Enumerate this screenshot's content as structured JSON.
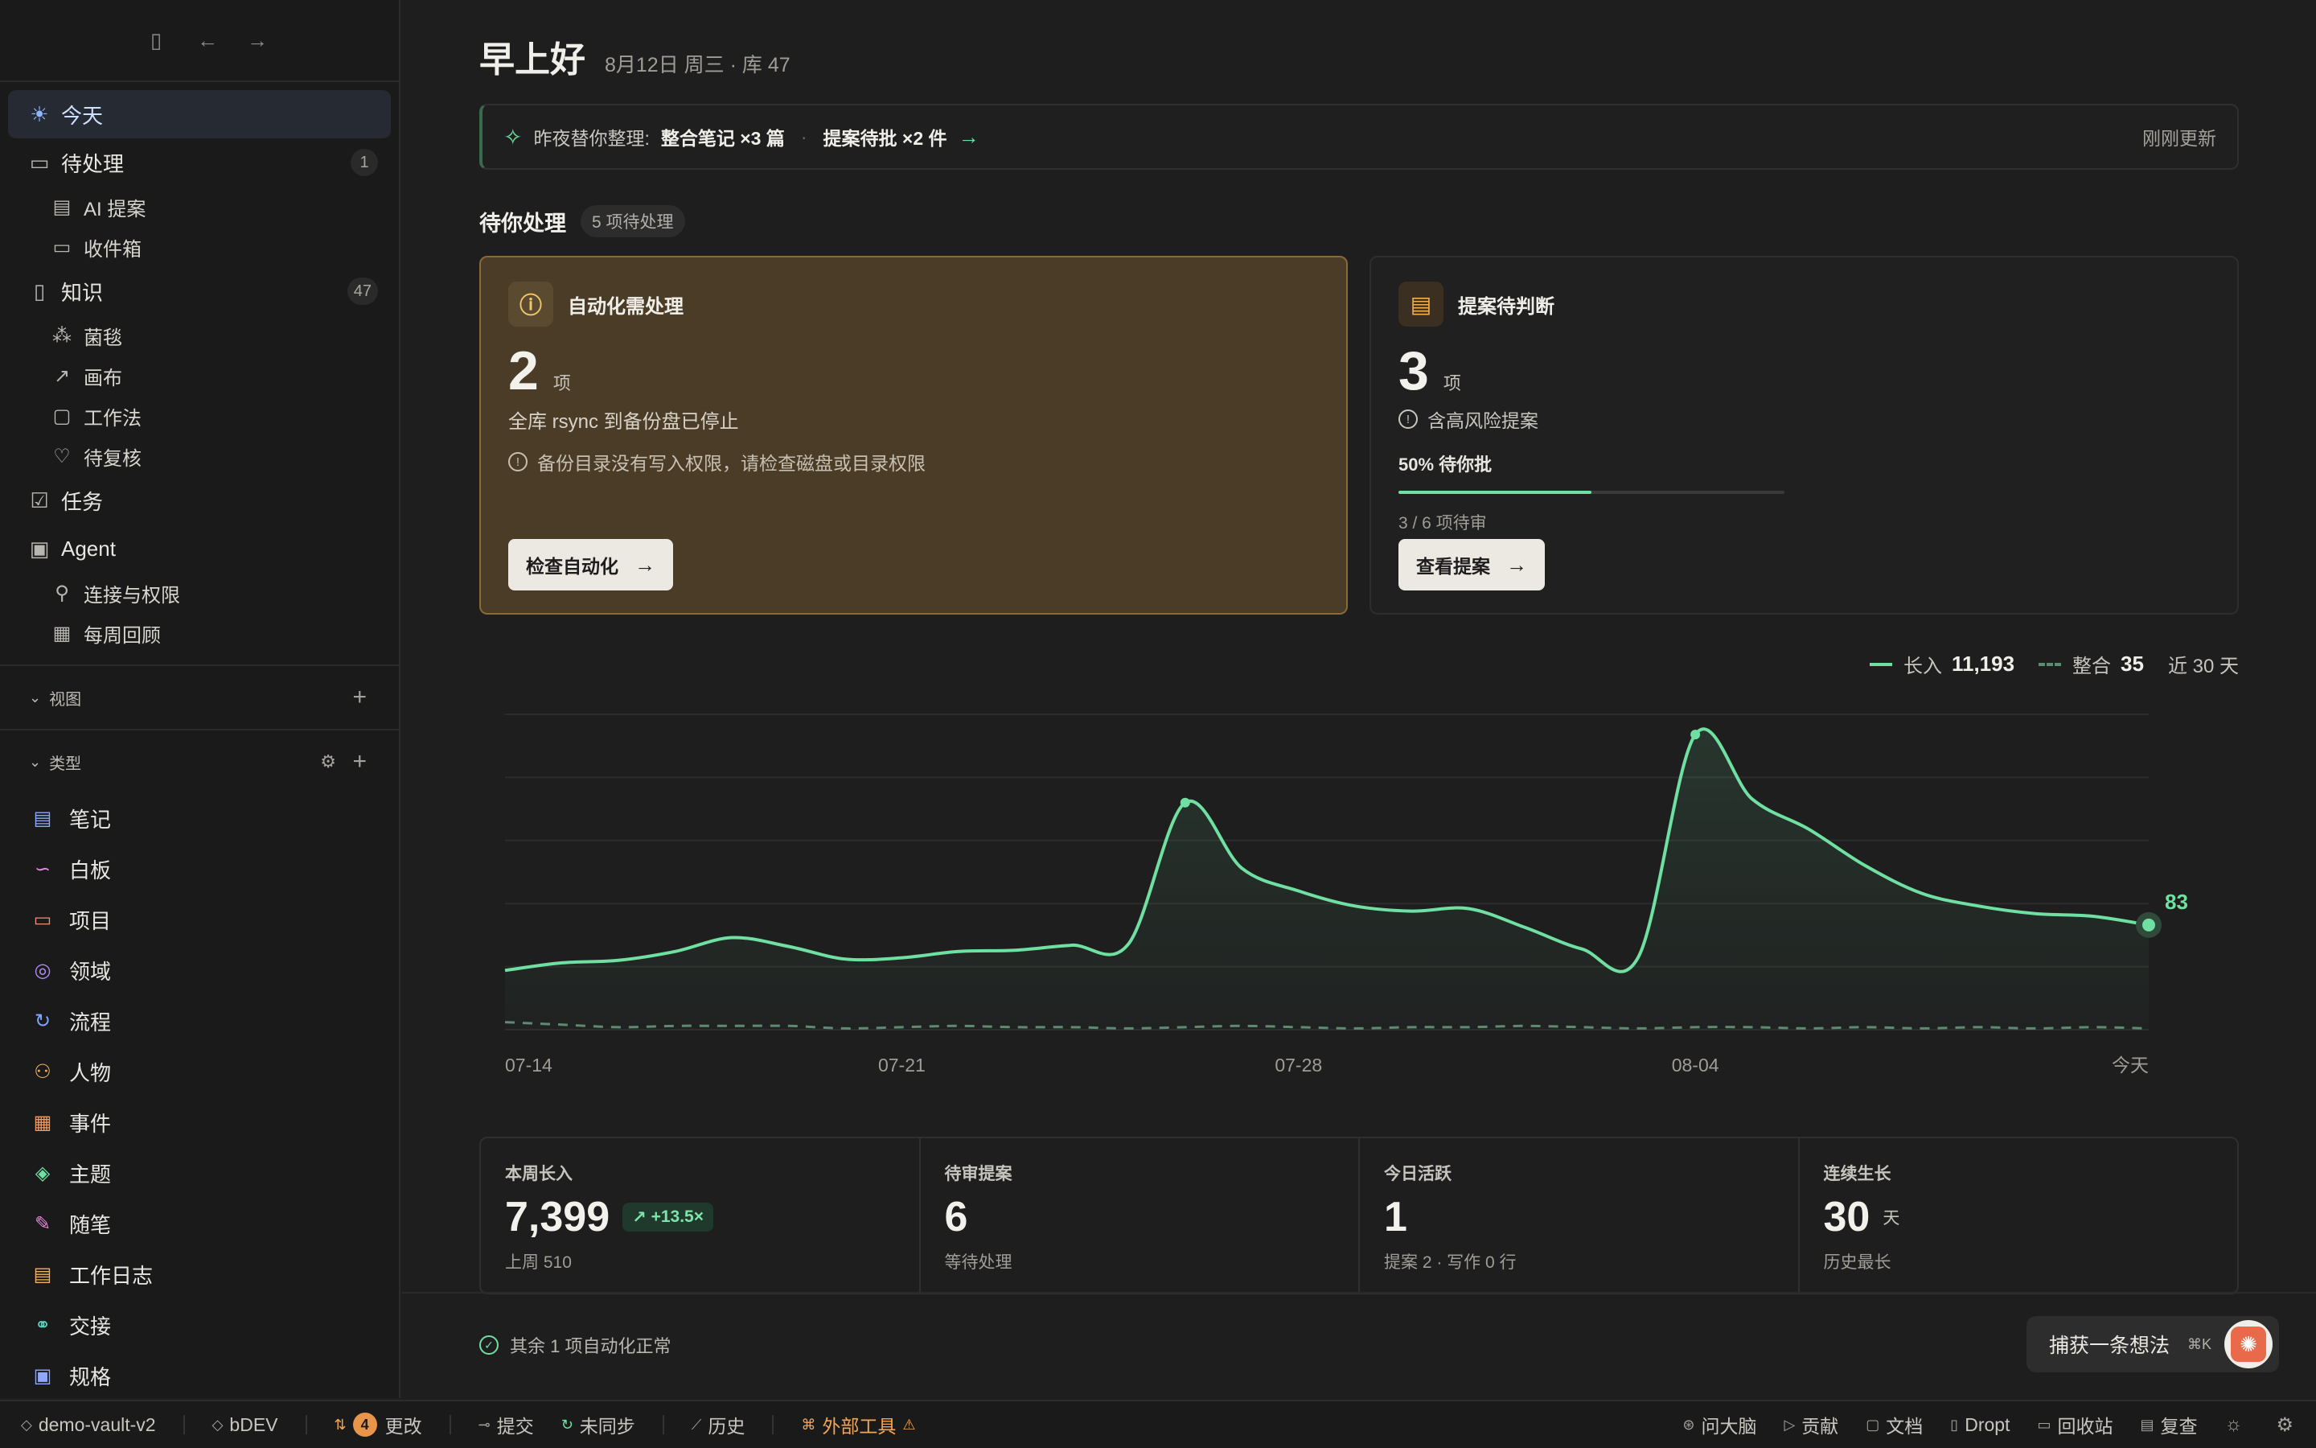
{
  "sidebar": {
    "nav": [
      {
        "label": "今天",
        "icon": "sun-icon"
      },
      {
        "label": "待处理",
        "icon": "inbox-icon",
        "count": "1"
      },
      {
        "label": "AI 提案",
        "icon": "clipboard-icon"
      },
      {
        "label": "收件箱",
        "icon": "tray-icon"
      },
      {
        "label": "知识",
        "icon": "document-icon",
        "count": "47"
      },
      {
        "label": "菌毯",
        "icon": "network-icon"
      },
      {
        "label": "画布",
        "icon": "pen-icon"
      },
      {
        "label": "工作法",
        "icon": "book-icon"
      },
      {
        "label": "待复核",
        "icon": "heart-icon"
      },
      {
        "label": "任务",
        "icon": "checkbox-icon"
      },
      {
        "label": "Agent",
        "icon": "robot-icon"
      },
      {
        "label": "连接与权限",
        "icon": "plug-icon"
      },
      {
        "label": "每周回顾",
        "icon": "calendar-check-icon"
      }
    ],
    "views_label": "视图",
    "types_label": "类型",
    "types": [
      {
        "label": "笔记",
        "icon": "note-icon",
        "color": "#8ea8ff"
      },
      {
        "label": "白板",
        "icon": "whiteboard-icon",
        "color": "#e38ad9"
      },
      {
        "label": "项目",
        "icon": "briefcase-icon",
        "color": "#f28a7a"
      },
      {
        "label": "领域",
        "icon": "target-icon",
        "color": "#b18cf2"
      },
      {
        "label": "流程",
        "icon": "refresh-icon",
        "color": "#7fa4ff"
      },
      {
        "label": "人物",
        "icon": "people-icon",
        "color": "#f2b35a"
      },
      {
        "label": "事件",
        "icon": "calendar-icon",
        "color": "#f29a5a"
      },
      {
        "label": "主题",
        "icon": "tag-icon",
        "color": "#6fe0a1"
      },
      {
        "label": "随笔",
        "icon": "feather-icon",
        "color": "#e38ad9"
      },
      {
        "label": "工作日志",
        "icon": "log-icon",
        "color": "#f2b35a"
      },
      {
        "label": "交接",
        "icon": "handshake-icon",
        "color": "#5fd6c0"
      },
      {
        "label": "规格",
        "icon": "spec-icon",
        "color": "#8ea8ff"
      }
    ]
  },
  "header": {
    "greeting": "早上好",
    "meta": "8月12日 周三 · 库 47"
  },
  "banner": {
    "prefix": "昨夜替你整理:",
    "item1": "整合笔记 ×3 篇",
    "item2": "提案待批 ×2 件",
    "updated": "刚刚更新"
  },
  "pending": {
    "title": "待你处理",
    "pill": "5 项待处理"
  },
  "card_auto": {
    "title": "自动化需处理",
    "count": "2",
    "unit": "项",
    "line1": "全库 rsync 到备份盘已停止",
    "line2": "备份目录没有写入权限，请检查磁盘或目录权限",
    "button": "检查自动化"
  },
  "card_proposal": {
    "title": "提案待判断",
    "count": "3",
    "unit": "项",
    "line1": "含高风险提案",
    "progress_label": "50% 待你批",
    "progress": 0.5,
    "progress_sub": "3 / 6 项待审",
    "button": "查看提案"
  },
  "legend": {
    "series1_label": "长入",
    "series1_value": "11,193",
    "series2_label": "整合",
    "series2_value": "35",
    "range": "近 30 天"
  },
  "chart_data": {
    "type": "area",
    "x_tick_labels": [
      "07-14",
      "07-21",
      "07-28",
      "08-04",
      "今天"
    ],
    "ylim": [
      0,
      250
    ],
    "grid": true,
    "series": [
      {
        "name": "长入",
        "color": "#6fe0a1",
        "values": [
          47,
          53,
          55,
          62,
          73,
          66,
          56,
          57,
          62,
          63,
          67,
          68,
          180,
          128,
          110,
          98,
          94,
          96,
          81,
          64,
          58,
          234,
          183,
          159,
          130,
          108,
          98,
          92,
          90,
          83
        ]
      },
      {
        "name": "整合",
        "color": "#5f8a72",
        "values": [
          6,
          4,
          2,
          3,
          3,
          3,
          1,
          2,
          3,
          2,
          2,
          1,
          2,
          3,
          2,
          1,
          2,
          2,
          3,
          2,
          1,
          2,
          2,
          1,
          2,
          1,
          2,
          1,
          2,
          1
        ]
      }
    ],
    "end_label": "83"
  },
  "stats": [
    {
      "label": "本周长入",
      "value": "7,399",
      "delta": "+13.5×",
      "sub": "上周 510"
    },
    {
      "label": "待审提案",
      "value": "6",
      "sub": "等待处理"
    },
    {
      "label": "今日活跃",
      "value": "1",
      "sub": "提案 2 · 写作 0 行"
    },
    {
      "label": "连续生长",
      "value": "30",
      "unit": "天",
      "sub": "历史最长"
    }
  ],
  "footer": {
    "ok_text": "其余 1 项自动化正常",
    "capture": "捕获一条想法",
    "shortcut": "⌘K"
  },
  "statusbar": {
    "vault": "demo-vault-v2",
    "branch": "bDEV",
    "changes_count": "4",
    "changes": "更改",
    "commit": "提交",
    "unsynced": "未同步",
    "history": "历史",
    "external": "外部工具",
    "right": [
      "问大脑",
      "贡献",
      "文档",
      "Dropt",
      "回收站",
      "复查"
    ]
  }
}
